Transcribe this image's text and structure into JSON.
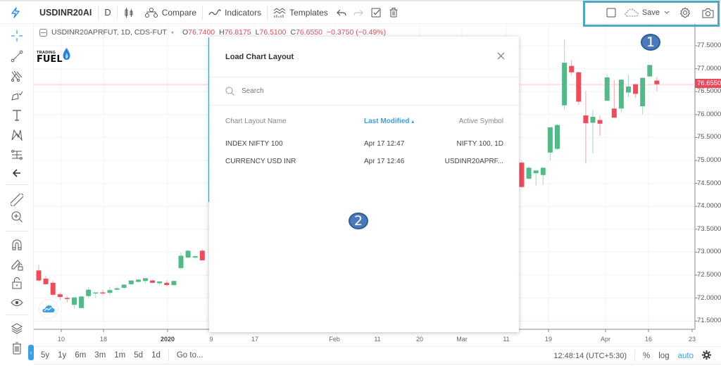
{
  "toolbar": {
    "symbol": "USDINR20AI",
    "interval": "D",
    "compare_label": "Compare",
    "indicators_label": "Indicators",
    "templates_label": "Templates",
    "save_label": "Save"
  },
  "legend": {
    "symbol_info": "USDINR20APRFUT, 1D, CDS-FUT",
    "open_label": "O",
    "open": "76.7400",
    "high_label": "H",
    "high": "76.8175",
    "low_label": "L",
    "low": "76.5100",
    "close_label": "C",
    "close": "76.6550",
    "change": "−0.3750 (−0.49%)"
  },
  "brand": {
    "line1": "TRADING",
    "line2": "FUEL"
  },
  "price_axis": {
    "labels": [
      "77.5000",
      "77.0000",
      "76.5000",
      "76.0000",
      "75.5000",
      "75.0000",
      "74.5000",
      "74.0000",
      "73.5000",
      "73.0000",
      "72.5000",
      "72.0000",
      "71.5000"
    ],
    "last_price": "76.6550"
  },
  "time_axis": {
    "labels": [
      {
        "text": "10",
        "bold": false
      },
      {
        "text": "18",
        "bold": false
      },
      {
        "text": "2020",
        "bold": true
      },
      {
        "text": "9",
        "bold": false
      },
      {
        "text": "17",
        "bold": false
      },
      {
        "text": "Feb",
        "bold": false
      },
      {
        "text": "11",
        "bold": false
      },
      {
        "text": "20",
        "bold": false
      },
      {
        "text": "Mar",
        "bold": false
      },
      {
        "text": "11",
        "bold": false
      },
      {
        "text": "19",
        "bold": false
      },
      {
        "text": "Apr",
        "bold": false
      },
      {
        "text": "16",
        "bold": false
      },
      {
        "text": "23",
        "bold": false
      }
    ]
  },
  "chart_data": {
    "type": "candlestick",
    "title": "USDINR20APRFUT, 1D, CDS-FUT",
    "ylim": [
      71.2,
      77.8
    ],
    "colors": {
      "up": "#53b987",
      "down": "#eb4d5c",
      "grid": "#eef4f8",
      "last_price_line": "#f4a7b0"
    },
    "candles_visible_left": [
      {
        "o": 72.6,
        "h": 72.72,
        "l": 72.35,
        "c": 72.38
      },
      {
        "o": 72.42,
        "h": 72.48,
        "l": 72.28,
        "c": 72.3
      },
      {
        "o": 72.33,
        "h": 72.38,
        "l": 72.05,
        "c": 72.07
      },
      {
        "o": 72.08,
        "h": 72.12,
        "l": 71.95,
        "c": 72.02
      },
      {
        "o": 72.0,
        "h": 72.04,
        "l": 71.9,
        "c": 71.99
      },
      {
        "o": 71.85,
        "h": 72.02,
        "l": 71.77,
        "c": 72.01
      },
      {
        "o": 71.78,
        "h": 72.04,
        "l": 71.77,
        "c": 72.03
      },
      {
        "o": 72.04,
        "h": 72.24,
        "l": 71.99,
        "c": 72.18
      },
      {
        "o": 72.1,
        "h": 72.12,
        "l": 72.0,
        "c": 72.12
      },
      {
        "o": 72.12,
        "h": 72.18,
        "l": 72.06,
        "c": 72.1
      },
      {
        "o": 72.11,
        "h": 72.24,
        "l": 72.06,
        "c": 72.17
      },
      {
        "o": 72.18,
        "h": 72.25,
        "l": 72.16,
        "c": 72.21
      },
      {
        "o": 72.22,
        "h": 72.3,
        "l": 72.2,
        "c": 72.29
      },
      {
        "o": 72.3,
        "h": 72.37,
        "l": 72.28,
        "c": 72.38
      },
      {
        "o": 72.35,
        "h": 72.41,
        "l": 72.34,
        "c": 72.4
      },
      {
        "o": 72.37,
        "h": 72.43,
        "l": 72.32,
        "c": 72.43
      },
      {
        "o": 72.38,
        "h": 72.4,
        "l": 72.32,
        "c": 72.33
      },
      {
        "o": 72.32,
        "h": 72.36,
        "l": 72.28,
        "c": 72.36
      },
      {
        "o": 72.33,
        "h": 72.38,
        "l": 72.26,
        "c": 72.28
      },
      {
        "o": 72.28,
        "h": 72.37,
        "l": 72.26,
        "c": 72.37
      },
      {
        "o": 72.65,
        "h": 72.99,
        "l": 72.62,
        "c": 72.92
      },
      {
        "o": 72.88,
        "h": 73.05,
        "l": 72.86,
        "c": 73.03
      },
      {
        "o": 72.88,
        "h": 72.93,
        "l": 72.84,
        "c": 72.91
      },
      {
        "o": 73.03,
        "h": 73.06,
        "l": 72.82,
        "c": 72.82
      }
    ],
    "candles_visible_right": [
      {
        "o": 74.95,
        "h": 74.98,
        "l": 74.4,
        "c": 74.42
      },
      {
        "o": 74.6,
        "h": 74.88,
        "l": 74.58,
        "c": 74.84
      },
      {
        "o": 74.72,
        "h": 74.78,
        "l": 74.44,
        "c": 74.78
      },
      {
        "o": 74.68,
        "h": 74.85,
        "l": 74.46,
        "c": 74.84
      },
      {
        "o": 75.17,
        "h": 75.5,
        "l": 75.0,
        "c": 75.72
      },
      {
        "o": 75.25,
        "h": 75.79,
        "l": 75.23,
        "c": 75.77
      },
      {
        "o": 76.2,
        "h": 77.64,
        "l": 76.11,
        "c": 77.13
      },
      {
        "o": 77.06,
        "h": 77.19,
        "l": 76.85,
        "c": 76.92
      },
      {
        "o": 76.92,
        "h": 76.94,
        "l": 76.21,
        "c": 76.28
      },
      {
        "o": 75.98,
        "h": 76.51,
        "l": 74.93,
        "c": 75.81
      },
      {
        "o": 75.82,
        "h": 76.1,
        "l": 75.15,
        "c": 75.95
      },
      {
        "o": 75.88,
        "h": 75.98,
        "l": 75.53,
        "c": 75.8
      },
      {
        "o": 76.3,
        "h": 76.88,
        "l": 76.3,
        "c": 76.81
      },
      {
        "o": 76.13,
        "h": 76.75,
        "l": 75.98,
        "c": 75.93
      },
      {
        "o": 76.13,
        "h": 76.76,
        "l": 76.03,
        "c": 76.76
      },
      {
        "o": 76.48,
        "h": 76.86,
        "l": 76.38,
        "c": 76.61
      },
      {
        "o": 76.66,
        "h": 76.68,
        "l": 76.36,
        "c": 76.45
      },
      {
        "o": 76.18,
        "h": 76.76,
        "l": 76.0,
        "c": 76.8
      },
      {
        "o": 76.83,
        "h": 77.07,
        "l": 76.83,
        "c": 77.08
      },
      {
        "o": 76.74,
        "h": 76.82,
        "l": 76.51,
        "c": 76.66
      }
    ]
  },
  "left_tools": [
    "crosshair",
    "trend-line",
    "pitchfork",
    "brush",
    "text",
    "pattern",
    "prediction",
    "back-arrow",
    "ruler",
    "zoom-in",
    "magnet",
    "lock-drawing",
    "lock",
    "eye",
    "layers",
    "trash"
  ],
  "bottombar": {
    "ranges": [
      "5y",
      "1y",
      "6m",
      "3m",
      "1m",
      "5d",
      "1d"
    ],
    "goto_label": "Go to...",
    "clock": "12:48:14 (UTC+5:30)",
    "percent_label": "%",
    "log_label": "log",
    "auto_label": "auto"
  },
  "dialog": {
    "title": "Load Chart Layout",
    "search_placeholder": "Search",
    "columns": {
      "name": "Chart Layout Name",
      "modified": "Last Modified",
      "symbol": "Active Symbol",
      "sort_indicator": "▴"
    },
    "rows": [
      {
        "name": "INDEX NIFTY 100",
        "modified": "Apr 17 12:47",
        "symbol": "NIFTY 100, 1D"
      },
      {
        "name": "CURRENCY USD INR",
        "modified": "Apr 17 12:46",
        "symbol": "USDINR20APRF..."
      }
    ]
  },
  "annotations": {
    "badge1": "1",
    "badge2": "2",
    "highlight_color": "#4ba9c4"
  }
}
